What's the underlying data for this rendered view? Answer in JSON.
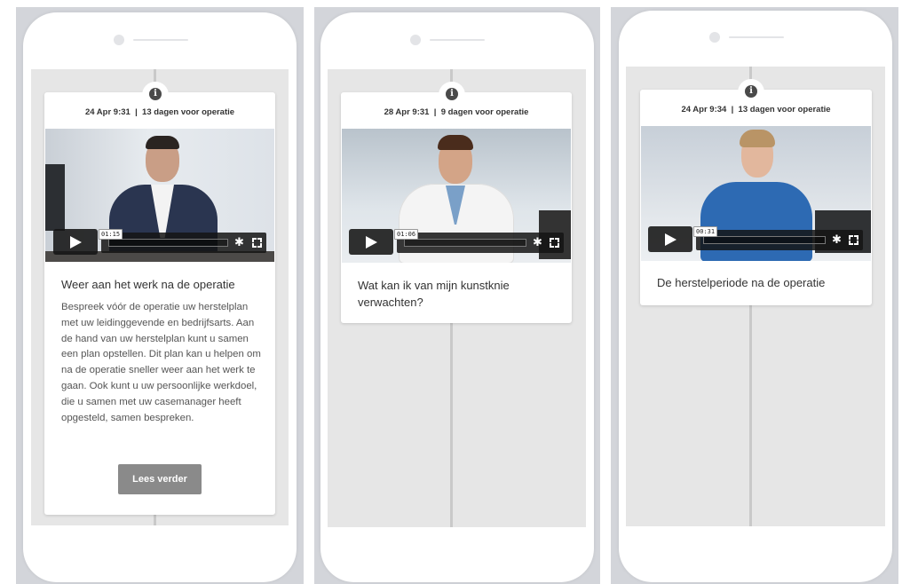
{
  "cards": [
    {
      "date": "24 Apr 9:31",
      "separator": "|",
      "days": "13 dagen voor operatie",
      "video_time": "01:15",
      "title": "Weer aan het werk na de operatie",
      "body": "Bespreek vóór de operatie uw herstelplan met uw leidinggevende en bedrijfsarts. Aan de hand van uw herstelplan kunt u samen een plan opstellen. Dit plan kan u helpen om na de operatie sneller weer aan het werk te gaan. Ook kunt u uw persoonlijke werkdoel, die u samen met uw casemanager heeft opgesteld, samen bespreken.",
      "button_label": "Lees verder"
    },
    {
      "date": "28 Apr 9:31",
      "separator": "|",
      "days": "9 dagen voor operatie",
      "video_time": "01:06",
      "title": "Wat kan ik van mijn kunstknie verwachten?"
    },
    {
      "date": "24 Apr 9:34",
      "separator": "|",
      "days": "13 dagen voor operatie",
      "video_time": "00:31",
      "title": "De herstelperiode na de operatie"
    }
  ],
  "icons": {
    "info": "info-icon",
    "play": "play-icon",
    "settings": "gear-icon",
    "fullscreen": "fullscreen-icon",
    "settings_glyph": "✱",
    "info_glyph": "i"
  },
  "colors": {
    "screen_bg": "#e6e6e6",
    "button_bg": "#8a8a8a",
    "outer_bg": "#d3d5da"
  }
}
